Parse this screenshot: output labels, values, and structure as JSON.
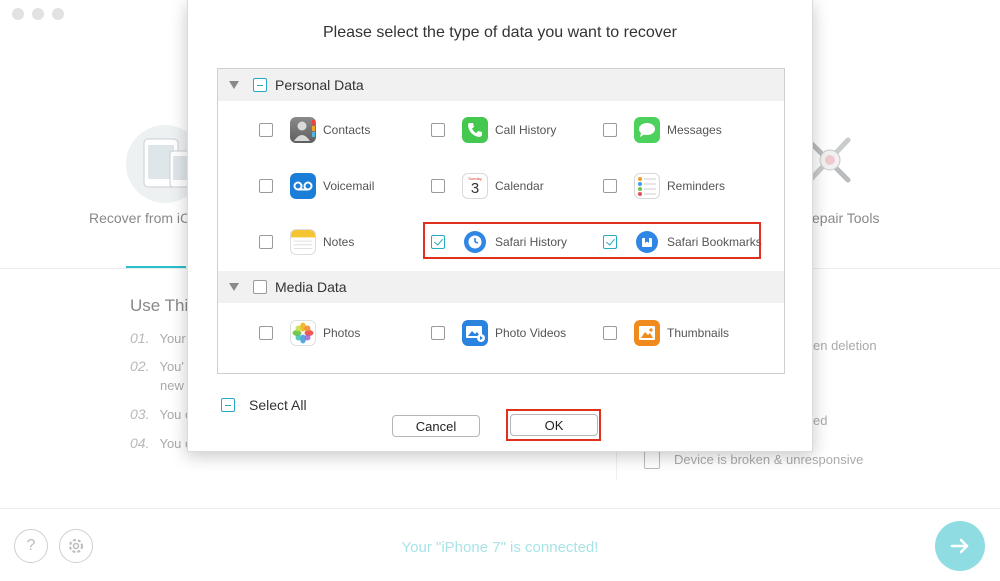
{
  "background": {
    "mode_left_label": "Recover from iC",
    "mode_right_label": "epair Tools",
    "use_title": "Use Thi",
    "steps": [
      {
        "num": "01.",
        "text": "Your"
      },
      {
        "num": "02.",
        "text": "You'",
        "text2": "new"
      },
      {
        "num": "03.",
        "text": "You c"
      },
      {
        "num": "04.",
        "text": "You c"
      }
    ],
    "right_items": [
      "en deletion",
      "ed",
      "Device is broken & unresponsive"
    ],
    "status": "Your \"iPhone 7\" is connected!",
    "help_glyph": "?"
  },
  "modal": {
    "title": "Please select the type of data you want to recover",
    "groups": [
      {
        "label": "Personal Data",
        "state": "partial",
        "items": [
          {
            "label": "Contacts",
            "icon": "contacts-icon",
            "checked": false
          },
          {
            "label": "Call History",
            "icon": "phone-icon",
            "checked": false
          },
          {
            "label": "Messages",
            "icon": "messages-icon",
            "checked": false
          },
          {
            "label": "Voicemail",
            "icon": "voicemail-icon",
            "checked": false
          },
          {
            "label": "Calendar",
            "icon": "calendar-icon",
            "checked": false,
            "calendar_day": "3",
            "calendar_weekday": "Sunday"
          },
          {
            "label": "Reminders",
            "icon": "reminders-icon",
            "checked": false
          },
          {
            "label": "Notes",
            "icon": "notes-icon",
            "checked": false
          },
          {
            "label": "Safari History",
            "icon": "safari-history-icon",
            "checked": true
          },
          {
            "label": "Safari Bookmarks",
            "icon": "safari-bookmarks-icon",
            "checked": true
          }
        ]
      },
      {
        "label": "Media Data",
        "state": "unchecked",
        "items": [
          {
            "label": "Photos",
            "icon": "photos-icon",
            "checked": false
          },
          {
            "label": "Photo Videos",
            "icon": "photo-videos-icon",
            "checked": false
          },
          {
            "label": "Thumbnails",
            "icon": "thumbnails-icon",
            "checked": false
          }
        ]
      }
    ],
    "select_all_label": "Select All",
    "cancel_label": "Cancel",
    "ok_label": "OK"
  },
  "colors": {
    "accent": "#27c0c9",
    "highlight": "#e0301e",
    "checkbox": "#27a9c1"
  }
}
